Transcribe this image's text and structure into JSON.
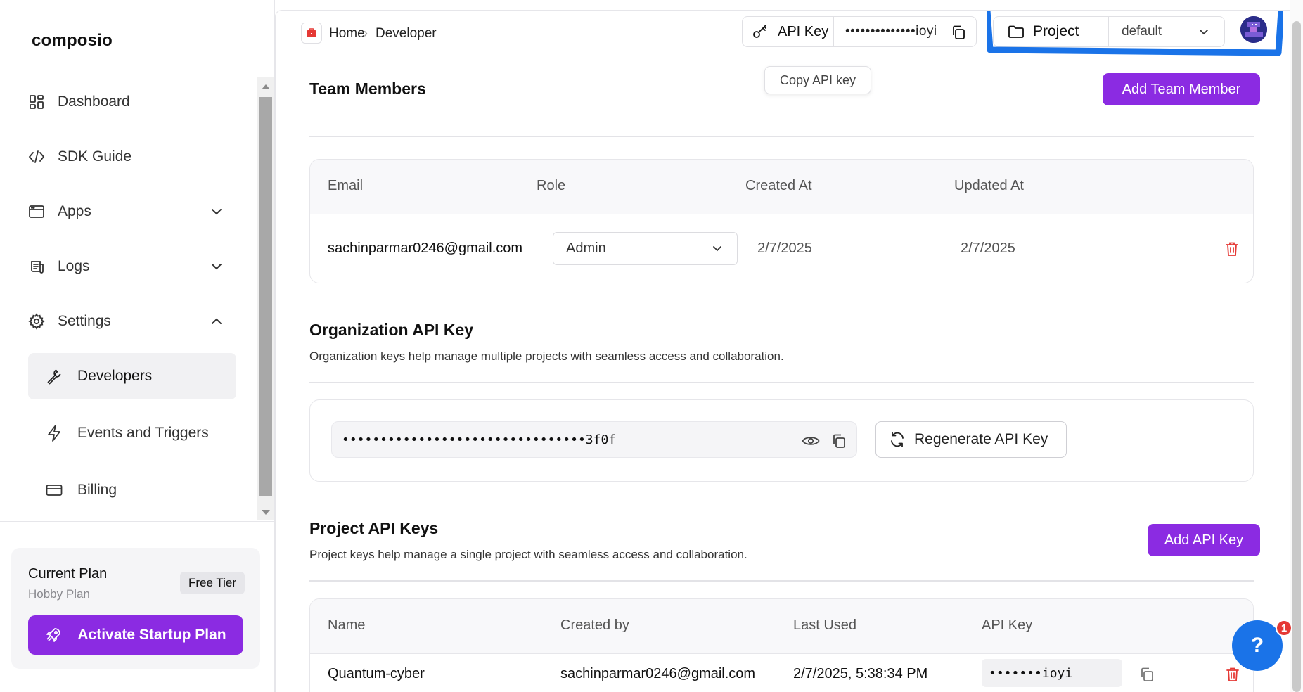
{
  "brand": {
    "logo_text": "composio",
    "accent": "#8b2be2"
  },
  "sidebar": {
    "items": [
      {
        "label": "Dashboard",
        "icon": "dashboard-icon"
      },
      {
        "label": "SDK Guide",
        "icon": "code-icon"
      },
      {
        "label": "Apps",
        "icon": "apps-icon",
        "expandable": true
      },
      {
        "label": "Logs",
        "icon": "logs-icon",
        "expandable": true
      },
      {
        "label": "Settings",
        "icon": "gear-icon",
        "expanded": true
      }
    ],
    "sub_items": [
      {
        "label": "Developers",
        "icon": "wrench-icon",
        "active": true
      },
      {
        "label": "Events and Triggers",
        "icon": "lightning-icon"
      },
      {
        "label": "Billing",
        "icon": "credit-card-icon"
      }
    ],
    "plan": {
      "title": "Current Plan",
      "subtitle": "Hobby Plan",
      "badge": "Free Tier",
      "button_label": "Activate Startup Plan"
    }
  },
  "topbar": {
    "breadcrumb": [
      "Home",
      "Developer"
    ],
    "api_key_label": "API Key",
    "api_key_value": "••••••••••••••ioyi",
    "project_label": "Project",
    "project_value": "default",
    "tooltip": "Copy API key"
  },
  "team": {
    "title": "Team Members",
    "add_button": "Add Team Member",
    "columns": [
      "Email",
      "Role",
      "Created At",
      "Updated At"
    ],
    "rows": [
      {
        "email": "sachinparmar0246@gmail.com",
        "role": "Admin",
        "created_at": "2/7/2025",
        "updated_at": "2/7/2025"
      }
    ]
  },
  "org_key": {
    "title": "Organization API Key",
    "description": "Organization keys help manage multiple projects with seamless access and collaboration.",
    "masked_value": "••••••••••••••••••••••••••••••••3f0f",
    "regenerate_label": "Regenerate API Key"
  },
  "project_keys": {
    "title": "Project API Keys",
    "description": "Project keys help manage a single project with seamless access and collaboration.",
    "add_button": "Add API Key",
    "columns": [
      "Name",
      "Created by",
      "Last Used",
      "API Key"
    ],
    "rows": [
      {
        "name": "Quantum-cyber",
        "created_by": "sachinparmar0246@gmail.com",
        "last_used": "2/7/2025, 5:38:34 PM",
        "api_key": "•••••••ioyi"
      }
    ]
  },
  "help": {
    "label": "?",
    "badge_count": "1"
  }
}
